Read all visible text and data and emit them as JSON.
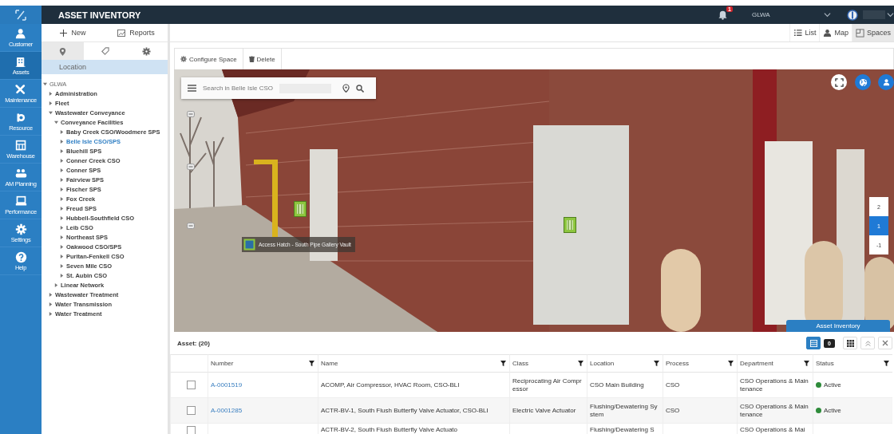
{
  "app": {
    "title": "ASSET INVENTORY"
  },
  "nav": [
    {
      "label": "Customer",
      "selected": false
    },
    {
      "label": "Assets",
      "selected": true
    },
    {
      "label": "Maintenance",
      "selected": false
    },
    {
      "label": "Resource",
      "selected": false
    },
    {
      "label": "Warehouse",
      "selected": false
    },
    {
      "label": "AM Planning",
      "selected": false
    },
    {
      "label": "Performance",
      "selected": false
    },
    {
      "label": "Settings",
      "selected": false
    },
    {
      "label": "Help",
      "selected": false
    }
  ],
  "header": {
    "notification_count": "1",
    "organization": "GLWA"
  },
  "left_panel": {
    "actions": [
      "New",
      "Reports"
    ],
    "tabs": [
      {
        "kind": "pin",
        "selected": true
      },
      {
        "kind": "tag",
        "selected": false
      },
      {
        "kind": "gear",
        "selected": false
      }
    ],
    "section": "Location",
    "tree": [
      {
        "label": "GLWA",
        "expanded": true,
        "selected": false,
        "children": [
          {
            "label": "Administration",
            "expanded": false,
            "selected": false
          },
          {
            "label": "Fleet",
            "expanded": false,
            "selected": false
          },
          {
            "label": "Wastewater Conveyance",
            "expanded": true,
            "selected": false,
            "children": [
              {
                "label": "Conveyance Facilities",
                "expanded": true,
                "selected": false,
                "children": [
                  {
                    "label": "Baby Creek CSO/Woodmere SPS",
                    "expanded": false,
                    "selected": false
                  },
                  {
                    "label": "Belle Isle CSO/SPS",
                    "expanded": false,
                    "selected": true
                  },
                  {
                    "label": "Bluehill SPS",
                    "expanded": false,
                    "selected": false
                  },
                  {
                    "label": "Conner Creek CSO",
                    "expanded": false,
                    "selected": false
                  },
                  {
                    "label": "Conner SPS",
                    "expanded": false,
                    "selected": false
                  },
                  {
                    "label": "Fairview SPS",
                    "expanded": false,
                    "selected": false
                  },
                  {
                    "label": "Fischer SPS",
                    "expanded": false,
                    "selected": false
                  },
                  {
                    "label": "Fox Creek",
                    "expanded": false,
                    "selected": false
                  },
                  {
                    "label": "Freud SPS",
                    "expanded": false,
                    "selected": false
                  },
                  {
                    "label": "Hubbell-Southfield CSO",
                    "expanded": false,
                    "selected": false
                  },
                  {
                    "label": "Leib CSO",
                    "expanded": false,
                    "selected": false
                  },
                  {
                    "label": "Northeast SPS",
                    "expanded": false,
                    "selected": false
                  },
                  {
                    "label": "Oakwood CSO/SPS",
                    "expanded": false,
                    "selected": false
                  },
                  {
                    "label": "Puritan-Fenkell CSO",
                    "expanded": false,
                    "selected": false
                  },
                  {
                    "label": "Seven Mile CSO",
                    "expanded": false,
                    "selected": false
                  },
                  {
                    "label": "St. Aubin CSO",
                    "expanded": false,
                    "selected": false
                  }
                ]
              },
              {
                "label": "Linear Network",
                "expanded": false,
                "selected": false
              }
            ]
          },
          {
            "label": "Wastewater Treatment",
            "expanded": false,
            "selected": false
          },
          {
            "label": "Water Transmission",
            "expanded": false,
            "selected": false
          },
          {
            "label": "Water Treatment",
            "expanded": false,
            "selected": false
          }
        ]
      }
    ]
  },
  "views": [
    {
      "label": "List",
      "selected": false
    },
    {
      "label": "Map",
      "selected": false
    },
    {
      "label": "Spaces",
      "selected": true
    }
  ],
  "space": {
    "actions": [
      "Configure Space",
      "Delete"
    ],
    "search_value": "Search in Belle Isle CSO",
    "marker_label": "Access Hatch - South Pipe Gallery Vault",
    "floors": [
      {
        "label": "2",
        "selected": false
      },
      {
        "label": "1",
        "selected": true
      },
      {
        "label": "-1",
        "selected": false
      }
    ],
    "panel_tab": "Asset Inventory"
  },
  "table": {
    "count_label": "Asset: (20)",
    "badge": "0",
    "columns": [
      "Number",
      "Name",
      "Class",
      "Location",
      "Process",
      "Department",
      "Status"
    ],
    "rows": [
      {
        "checked": false,
        "number": "A-0001519",
        "name": "ACOMP, Air Compressor, HVAC Room, CSO-BLI",
        "class": "Reciprocating Air Compressor",
        "location": "CSO Main Building",
        "process": "CSO",
        "department": "CSO Operations & Maintenance",
        "status": {
          "text": "Active",
          "color": "#2e8b3a"
        }
      },
      {
        "checked": false,
        "number": "A-0001285",
        "name": "ACTR-BV-1, South Flush Butterfly Valve Actuator, CSO-BLI",
        "class": "Electric Valve Actuator",
        "location": "Flushing/Dewatering System",
        "process": "CSO",
        "department": "CSO Operations & Maintenance",
        "status": {
          "text": "Active",
          "color": "#2e8b3a"
        }
      },
      {
        "checked": false,
        "name": "ACTR-BV-2, South Flush Butterfly Valve Actuato",
        "location": "Flushing/Dewatering S",
        "department": "CSO Operations & Mai"
      }
    ]
  }
}
